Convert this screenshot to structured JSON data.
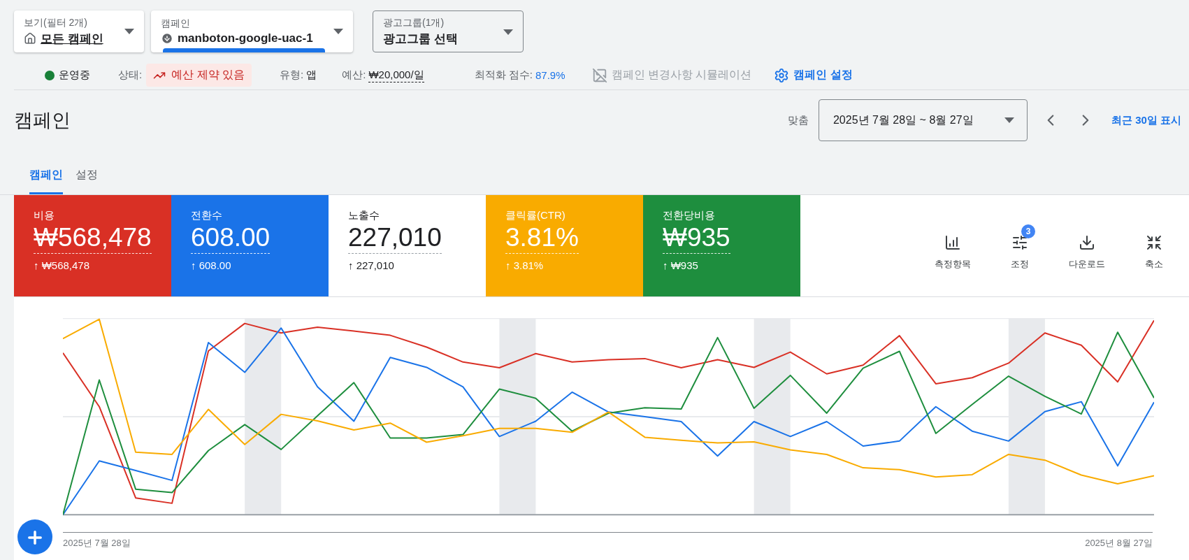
{
  "filters": [
    {
      "label": "보기(필터 2개)",
      "value": "모든 캠페인",
      "kind": "view",
      "focused": false
    },
    {
      "label": "캠페인",
      "value": "manboton-google-uac-1",
      "kind": "campaign",
      "focused": true
    },
    {
      "label": "광고그룹(1개)",
      "value": "광고그룹 선택",
      "kind": "adgroup",
      "focused": false
    }
  ],
  "status_bar": {
    "state": "운영중",
    "status_label": "상태:",
    "status_value": "예산 제약 있음",
    "type_label": "유형:",
    "type_value": "앱",
    "budget_label": "예산:",
    "budget_value": "₩20,000/일",
    "score_label": "최적화 점수:",
    "score_value": "87.9%",
    "simulate": {
      "label": "캠페인 변경사항 시뮬레이션",
      "disabled": true
    },
    "settings": "캠페인 설정"
  },
  "page_title": "캠페인",
  "date_range": {
    "label": "맞춤",
    "value": "2025년 7월 28일 ~ 8월 27일"
  },
  "recent_link": "최근 30일 표시",
  "tabs": [
    {
      "label": "캠페인",
      "selected": true
    },
    {
      "label": "설정",
      "selected": false
    }
  ],
  "metrics": [
    {
      "label": "비용",
      "value": "₩568,478",
      "change": "↑ ₩568,478",
      "color": "#d93025",
      "selected": true
    },
    {
      "label": "전환수",
      "value": "608.00",
      "change": "↑ 608.00",
      "color": "#1a73e8",
      "selected": true
    },
    {
      "label": "노출수",
      "value": "227,010",
      "change": "↑ 227,010",
      "selected": false
    },
    {
      "label": "클릭률(CTR)",
      "value": "3.81%",
      "change": "↑ 3.81%",
      "color": "#f9ab00",
      "selected": true
    },
    {
      "label": "전환당비용",
      "value": "₩935",
      "change": "↑ ₩935",
      "color": "#1e8e3e",
      "selected": true
    }
  ],
  "tools": [
    {
      "label": "측정항목",
      "kind": "columns"
    },
    {
      "label": "조정",
      "kind": "adjust",
      "badge": "3"
    },
    {
      "label": "다운로드",
      "kind": "download"
    },
    {
      "label": "축소",
      "kind": "collapse"
    }
  ],
  "chart": {
    "start_label": "2025년 7월 28일",
    "end_label": "2025년 8월 27일"
  }
}
